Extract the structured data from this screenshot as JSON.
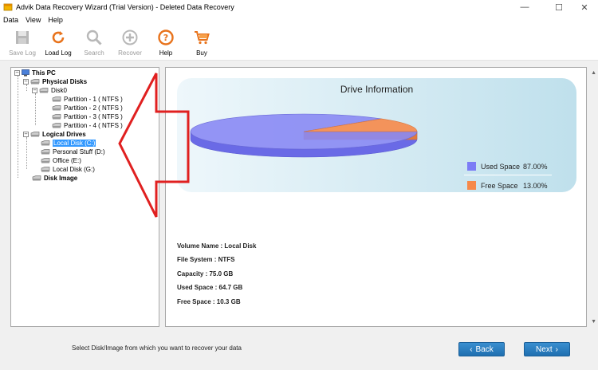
{
  "window": {
    "title": "Advik Data Recovery Wizard (Trial Version) - Deleted Data Recovery",
    "minimize": "—",
    "maximize": "☐",
    "close": "✕"
  },
  "menu": [
    "Data",
    "View",
    "Help"
  ],
  "toolbar": {
    "save_log": "Save Log",
    "load_log": "Load Log",
    "search": "Search",
    "recover": "Recover",
    "help": "Help",
    "buy": "Buy"
  },
  "tree": {
    "root": "This PC",
    "physical_disks": "Physical Disks",
    "disk0": "Disk0",
    "partitions": [
      "Partition - 1 ( NTFS )",
      "Partition - 2 ( NTFS )",
      "Partition - 3 ( NTFS )",
      "Partition - 4 ( NTFS )"
    ],
    "logical_drives": "Logical Drives",
    "drives": [
      "Local Disk (C:)",
      "Personal Stuff (D:)",
      "Office (E:)",
      "Local Disk (G:)"
    ],
    "disk_image": "Disk Image"
  },
  "drive_info": {
    "title": "Drive Information",
    "legend": [
      {
        "label": "Used Space",
        "percent": "87.00%",
        "color": "#7c7cf6"
      },
      {
        "label": "Free Space",
        "percent": "13.00%",
        "color": "#f6894a"
      }
    ],
    "used_fraction": 0.87,
    "free_fraction": 0.13
  },
  "details": {
    "volume_name": "Volume Name : Local Disk",
    "file_system": "File System : NTFS",
    "capacity": "Capacity : 75.0 GB",
    "used_space": "Used Space : 64.7 GB",
    "free_space": "Free Space : 10.3 GB"
  },
  "footer": {
    "hint": "Select Disk/Image from which you want to recover your data",
    "back": "Back",
    "next": "Next"
  },
  "colors": {
    "accent_red": "#e02020",
    "button_blue": "#2a7cc0",
    "selection": "#3399ff"
  }
}
